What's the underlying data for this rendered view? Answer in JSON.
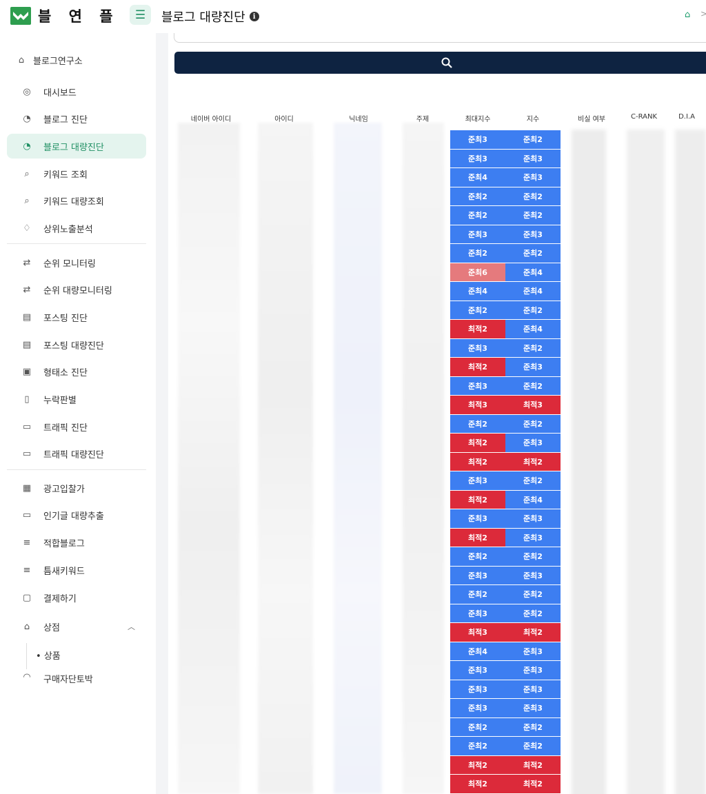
{
  "header": {
    "brand": "블 연 플",
    "menu_icon": "hamburger-icon",
    "title": "블로그 대량진단",
    "info_icon": "info-icon",
    "home_icon": "home-icon",
    "breadcrumb_sep": ">"
  },
  "sidebar": {
    "root": "블로그연구소",
    "items": [
      {
        "label": "대시보드",
        "icon": "dashboard-icon"
      },
      {
        "label": "블로그 진단",
        "icon": "pie-chart-icon"
      },
      {
        "label": "블로그 대량진단",
        "icon": "pie-chart-icon"
      },
      {
        "label": "키워드 조회",
        "icon": "keyword-search-icon"
      },
      {
        "label": "키워드 대량조회",
        "icon": "keyword-search-icon"
      },
      {
        "label": "상위노출분석",
        "icon": "diamond-icon"
      },
      {
        "label": "순위 모니터링",
        "icon": "repeat-icon"
      },
      {
        "label": "순위 대량모니터링",
        "icon": "repeat-icon"
      },
      {
        "label": "포스팅 진단",
        "icon": "doc-search-icon"
      },
      {
        "label": "포스팅 대량진단",
        "icon": "doc-search-icon"
      },
      {
        "label": "형태소 진단",
        "icon": "clipboard-icon"
      },
      {
        "label": "누락판별",
        "icon": "file-icon"
      },
      {
        "label": "트래픽 진단",
        "icon": "presentation-icon"
      },
      {
        "label": "트래픽 대량진단",
        "icon": "presentation-icon"
      },
      {
        "label": "광고입찰가",
        "icon": "ad-icon"
      },
      {
        "label": "인기글 대량추출",
        "icon": "presentation-icon"
      },
      {
        "label": "적합블로그",
        "icon": "list-search-icon"
      },
      {
        "label": "틈새키워드",
        "icon": "list-search-icon"
      },
      {
        "label": "결제하기",
        "icon": "payment-icon"
      },
      {
        "label": "상점",
        "icon": "basket-icon"
      }
    ],
    "sub_item": "상품",
    "partial_item": "구매자단토박"
  },
  "colors": {
    "accent": "#1f8f63",
    "navy": "#0e2341",
    "blue_cell": "#3d7ef1",
    "red_cell": "#dc2a3a",
    "pink_cell": "#e57a7d"
  },
  "table": {
    "search_icon": "search-icon",
    "columns": [
      "네이버 아이디",
      "아이디",
      "닉네임",
      "주제",
      "최대지수",
      "지수",
      "비실 여부",
      "C-RANK",
      "D.I.A"
    ],
    "rows": [
      [
        "준최3",
        "준최2"
      ],
      [
        "준최3",
        "준최3"
      ],
      [
        "준최4",
        "준최3"
      ],
      [
        "준최2",
        "준최2"
      ],
      [
        "준최2",
        "준최2"
      ],
      [
        "준최3",
        "준최3"
      ],
      [
        "준최2",
        "준최2"
      ],
      [
        "준최6",
        "준최4"
      ],
      [
        "준최4",
        "준최4"
      ],
      [
        "준최2",
        "준최2"
      ],
      [
        "최적2",
        "준최4"
      ],
      [
        "준최3",
        "준최2"
      ],
      [
        "최적2",
        "준최3"
      ],
      [
        "준최3",
        "준최2"
      ],
      [
        "최적3",
        "최적3"
      ],
      [
        "준최2",
        "준최2"
      ],
      [
        "최적2",
        "준최3"
      ],
      [
        "최적2",
        "최적2"
      ],
      [
        "준최3",
        "준최2"
      ],
      [
        "최적2",
        "준최4"
      ],
      [
        "준최3",
        "준최3"
      ],
      [
        "최적2",
        "준최3"
      ],
      [
        "준최2",
        "준최2"
      ],
      [
        "준최3",
        "준최3"
      ],
      [
        "준최2",
        "준최2"
      ],
      [
        "준최3",
        "준최2"
      ],
      [
        "최적3",
        "최적2"
      ],
      [
        "준최4",
        "준최3"
      ],
      [
        "준최3",
        "준최3"
      ],
      [
        "준최3",
        "준최3"
      ],
      [
        "준최3",
        "준최3"
      ],
      [
        "준최2",
        "준최2"
      ],
      [
        "준최2",
        "준최2"
      ],
      [
        "최적2",
        "최적2"
      ],
      [
        "최적2",
        "최적2"
      ]
    ]
  }
}
